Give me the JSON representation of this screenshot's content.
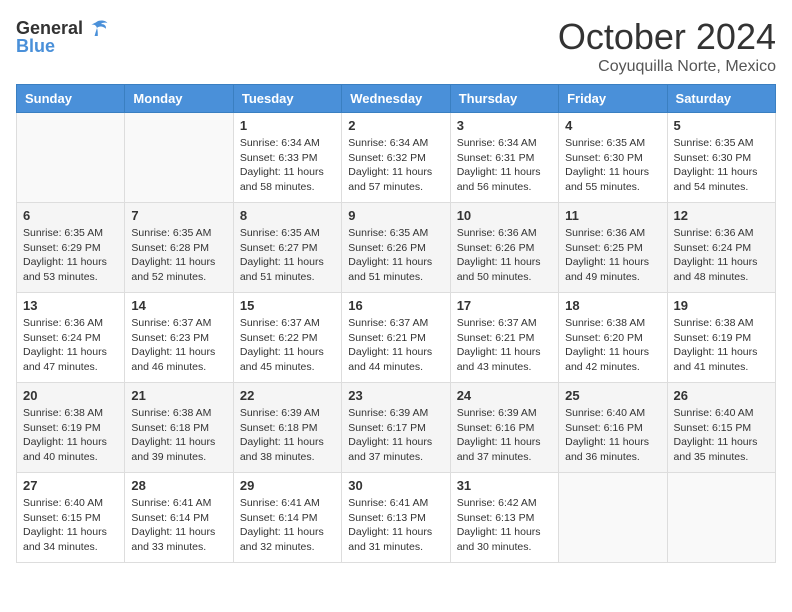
{
  "header": {
    "logo_general": "General",
    "logo_blue": "Blue",
    "month_title": "October 2024",
    "location": "Coyuquilla Norte, Mexico"
  },
  "days_of_week": [
    "Sunday",
    "Monday",
    "Tuesday",
    "Wednesday",
    "Thursday",
    "Friday",
    "Saturday"
  ],
  "weeks": [
    [
      {
        "day": "",
        "info": ""
      },
      {
        "day": "",
        "info": ""
      },
      {
        "day": "1",
        "sunrise": "6:34 AM",
        "sunset": "6:33 PM",
        "daylight": "11 hours and 58 minutes."
      },
      {
        "day": "2",
        "sunrise": "6:34 AM",
        "sunset": "6:32 PM",
        "daylight": "11 hours and 57 minutes."
      },
      {
        "day": "3",
        "sunrise": "6:34 AM",
        "sunset": "6:31 PM",
        "daylight": "11 hours and 56 minutes."
      },
      {
        "day": "4",
        "sunrise": "6:35 AM",
        "sunset": "6:30 PM",
        "daylight": "11 hours and 55 minutes."
      },
      {
        "day": "5",
        "sunrise": "6:35 AM",
        "sunset": "6:30 PM",
        "daylight": "11 hours and 54 minutes."
      }
    ],
    [
      {
        "day": "6",
        "sunrise": "6:35 AM",
        "sunset": "6:29 PM",
        "daylight": "11 hours and 53 minutes."
      },
      {
        "day": "7",
        "sunrise": "6:35 AM",
        "sunset": "6:28 PM",
        "daylight": "11 hours and 52 minutes."
      },
      {
        "day": "8",
        "sunrise": "6:35 AM",
        "sunset": "6:27 PM",
        "daylight": "11 hours and 51 minutes."
      },
      {
        "day": "9",
        "sunrise": "6:35 AM",
        "sunset": "6:26 PM",
        "daylight": "11 hours and 51 minutes."
      },
      {
        "day": "10",
        "sunrise": "6:36 AM",
        "sunset": "6:26 PM",
        "daylight": "11 hours and 50 minutes."
      },
      {
        "day": "11",
        "sunrise": "6:36 AM",
        "sunset": "6:25 PM",
        "daylight": "11 hours and 49 minutes."
      },
      {
        "day": "12",
        "sunrise": "6:36 AM",
        "sunset": "6:24 PM",
        "daylight": "11 hours and 48 minutes."
      }
    ],
    [
      {
        "day": "13",
        "sunrise": "6:36 AM",
        "sunset": "6:24 PM",
        "daylight": "11 hours and 47 minutes."
      },
      {
        "day": "14",
        "sunrise": "6:37 AM",
        "sunset": "6:23 PM",
        "daylight": "11 hours and 46 minutes."
      },
      {
        "day": "15",
        "sunrise": "6:37 AM",
        "sunset": "6:22 PM",
        "daylight": "11 hours and 45 minutes."
      },
      {
        "day": "16",
        "sunrise": "6:37 AM",
        "sunset": "6:21 PM",
        "daylight": "11 hours and 44 minutes."
      },
      {
        "day": "17",
        "sunrise": "6:37 AM",
        "sunset": "6:21 PM",
        "daylight": "11 hours and 43 minutes."
      },
      {
        "day": "18",
        "sunrise": "6:38 AM",
        "sunset": "6:20 PM",
        "daylight": "11 hours and 42 minutes."
      },
      {
        "day": "19",
        "sunrise": "6:38 AM",
        "sunset": "6:19 PM",
        "daylight": "11 hours and 41 minutes."
      }
    ],
    [
      {
        "day": "20",
        "sunrise": "6:38 AM",
        "sunset": "6:19 PM",
        "daylight": "11 hours and 40 minutes."
      },
      {
        "day": "21",
        "sunrise": "6:38 AM",
        "sunset": "6:18 PM",
        "daylight": "11 hours and 39 minutes."
      },
      {
        "day": "22",
        "sunrise": "6:39 AM",
        "sunset": "6:18 PM",
        "daylight": "11 hours and 38 minutes."
      },
      {
        "day": "23",
        "sunrise": "6:39 AM",
        "sunset": "6:17 PM",
        "daylight": "11 hours and 37 minutes."
      },
      {
        "day": "24",
        "sunrise": "6:39 AM",
        "sunset": "6:16 PM",
        "daylight": "11 hours and 37 minutes."
      },
      {
        "day": "25",
        "sunrise": "6:40 AM",
        "sunset": "6:16 PM",
        "daylight": "11 hours and 36 minutes."
      },
      {
        "day": "26",
        "sunrise": "6:40 AM",
        "sunset": "6:15 PM",
        "daylight": "11 hours and 35 minutes."
      }
    ],
    [
      {
        "day": "27",
        "sunrise": "6:40 AM",
        "sunset": "6:15 PM",
        "daylight": "11 hours and 34 minutes."
      },
      {
        "day": "28",
        "sunrise": "6:41 AM",
        "sunset": "6:14 PM",
        "daylight": "11 hours and 33 minutes."
      },
      {
        "day": "29",
        "sunrise": "6:41 AM",
        "sunset": "6:14 PM",
        "daylight": "11 hours and 32 minutes."
      },
      {
        "day": "30",
        "sunrise": "6:41 AM",
        "sunset": "6:13 PM",
        "daylight": "11 hours and 31 minutes."
      },
      {
        "day": "31",
        "sunrise": "6:42 AM",
        "sunset": "6:13 PM",
        "daylight": "11 hours and 30 minutes."
      },
      {
        "day": "",
        "info": ""
      },
      {
        "day": "",
        "info": ""
      }
    ]
  ],
  "labels": {
    "sunrise": "Sunrise:",
    "sunset": "Sunset:",
    "daylight": "Daylight:"
  }
}
